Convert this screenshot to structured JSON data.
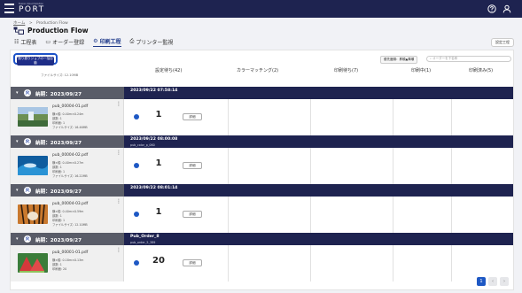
{
  "header": {
    "brand_small": "Fusion Cloud Solution",
    "brand": "PORT",
    "icons": [
      "menu-icon",
      "help-icon",
      "user-icon"
    ]
  },
  "breadcrumb": [
    "ホーム",
    ">",
    "Production Flow"
  ],
  "page": {
    "title": "Production Flow"
  },
  "tabs": [
    {
      "label": "工程表",
      "icon": "gantt-icon",
      "active": false
    },
    {
      "label": "オーダー登録",
      "icon": "order-icon",
      "active": false
    },
    {
      "label": "印刷工程",
      "icon": "print-icon",
      "active": true
    },
    {
      "label": "プリンター監視",
      "icon": "printer-monitor-icon",
      "active": false
    }
  ],
  "settings_label": "設定工程",
  "toolbar": {
    "job_button": "割り振りジョブの一括自動",
    "sort_button": "優先度順：昇順▲降順",
    "search_placeholder": "オーダーを下名称"
  },
  "columns": [
    {
      "label": "設定待ち(42)"
    },
    {
      "label": "カラーマッチング(2)"
    },
    {
      "label": "印刷待ち(7)"
    },
    {
      "label": "印刷中(1)"
    },
    {
      "label": "印刷済み(5)"
    }
  ],
  "partial_meta": "ファイルサイズ: 12.10MB",
  "groups": [
    {
      "title": "納期：2023/09/27",
      "badge": "火",
      "row_title": "2023/09/22 07:58:14",
      "row_sub": "",
      "job": {
        "file": "pub_00004-01.pdf",
        "size_line": "横×縦: 0.40m×0.24m",
        "copies_line": "部数: 1",
        "layers_line": "印刷面: 1",
        "file_size": "ファイルサイズ: 16.46MB",
        "qty": "1",
        "status": "詳細",
        "thumb": "waterfall"
      }
    },
    {
      "title": "納期：2023/09/27",
      "badge": "火",
      "row_title": "2023/09/22 08:00:08",
      "row_sub": "pub_color_p_060",
      "job": {
        "file": "pub_00004-02.pdf",
        "size_line": "横×縦: 0.40m×0.27m",
        "copies_line": "部数: 1",
        "layers_line": "印刷面: 1",
        "file_size": "ファイルサイズ: 16.22MB",
        "qty": "1",
        "status": "詳細",
        "thumb": "ocean"
      }
    },
    {
      "title": "納期：2023/09/27",
      "badge": "火",
      "row_title": "2023/09/22 08:01:14",
      "row_sub": "",
      "job": {
        "file": "pub_00004-03.pdf",
        "size_line": "横×縦: 0.40m×0.59m",
        "copies_line": "部数: 1",
        "layers_line": "印刷面: 1",
        "file_size": "ファイルサイズ: 12.10MB",
        "qty": "1",
        "status": "詳細",
        "thumb": "tiger"
      }
    },
    {
      "title": "納期：2023/09/27",
      "badge": "火",
      "row_title": "Pub_Order_8",
      "row_sub": "pub_order_5_389",
      "job": {
        "file": "pub_00001-01.pdf",
        "size_line": "横×縦: 0.18m×0.13m",
        "copies_line": "部数: 1",
        "layers_line": "印刷面: 20",
        "file_size": "",
        "qty": "20",
        "status": "詳細",
        "thumb": "watermelon"
      }
    }
  ],
  "pagination": {
    "pages": [
      "1",
      "‹",
      "›"
    ],
    "current": "1"
  },
  "colors": {
    "topbar": "#1e2350",
    "accent": "#1e58c4",
    "group_bar": "#595c68",
    "row_head": "#1e2350"
  }
}
